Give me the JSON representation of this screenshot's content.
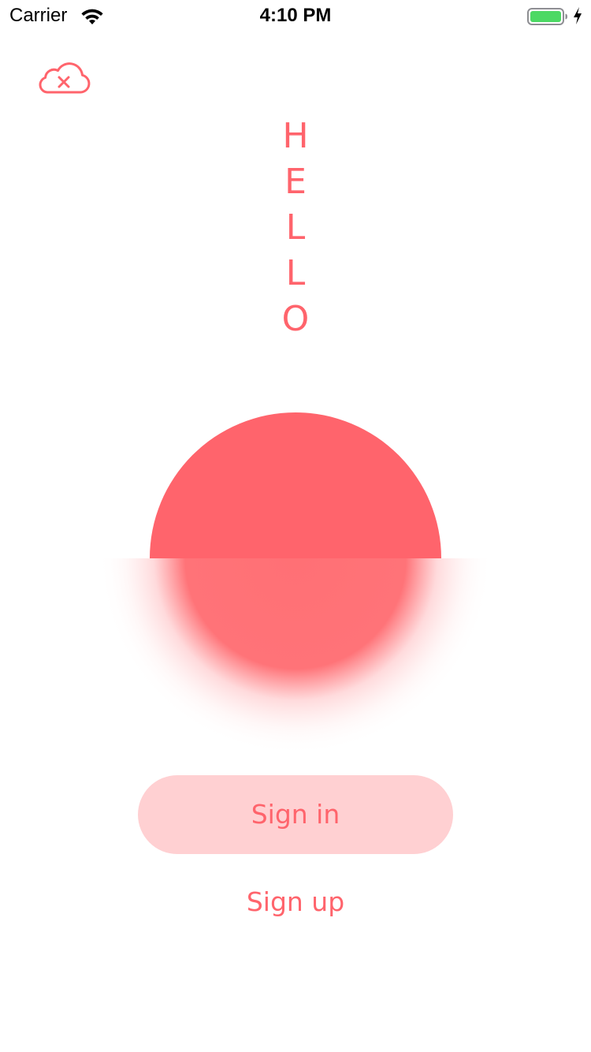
{
  "status_bar": {
    "carrier": "Carrier",
    "time": "4:10 PM",
    "battery_color": "#4cd964"
  },
  "top_icon": {
    "name": "cloud-off-icon",
    "color": "#ff646c"
  },
  "hero": {
    "letters": [
      "H",
      "E",
      "L",
      "L",
      "O"
    ],
    "accent_color": "#ff646c"
  },
  "actions": {
    "sign_in_label": "Sign in",
    "sign_up_label": "Sign up",
    "sign_in_bg": "#ffd0d2"
  }
}
